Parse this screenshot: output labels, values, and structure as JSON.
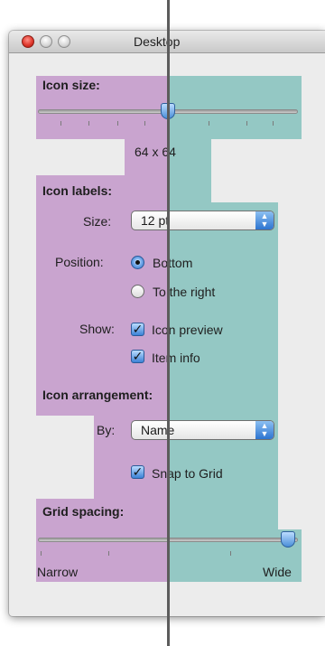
{
  "window": {
    "title": "Desktop"
  },
  "icon_size": {
    "label": "Icon size:",
    "value_text": "64 x 64"
  },
  "icon_labels": {
    "label": "Icon labels:",
    "size_label": "Size:",
    "size_value": "12 pt",
    "position_label": "Position:",
    "position_options": [
      "Bottom",
      "To the right"
    ],
    "position_selected": "Bottom",
    "show_label": "Show:",
    "show_options": [
      "Icon preview",
      "Item info"
    ]
  },
  "icon_arrangement": {
    "label": "Icon arrangement:",
    "by_label": "By:",
    "by_value": "Name",
    "snap_label": "Snap to Grid"
  },
  "grid_spacing": {
    "label": "Grid spacing:",
    "min_label": "Narrow",
    "max_label": "Wide"
  },
  "colors": {
    "highlight_left": "#c9a4cf",
    "highlight_right": "#94c8c4",
    "accent": "#3b82d6"
  },
  "icons": {
    "checkmark": "✓",
    "popup_arrows": "▲▼"
  }
}
